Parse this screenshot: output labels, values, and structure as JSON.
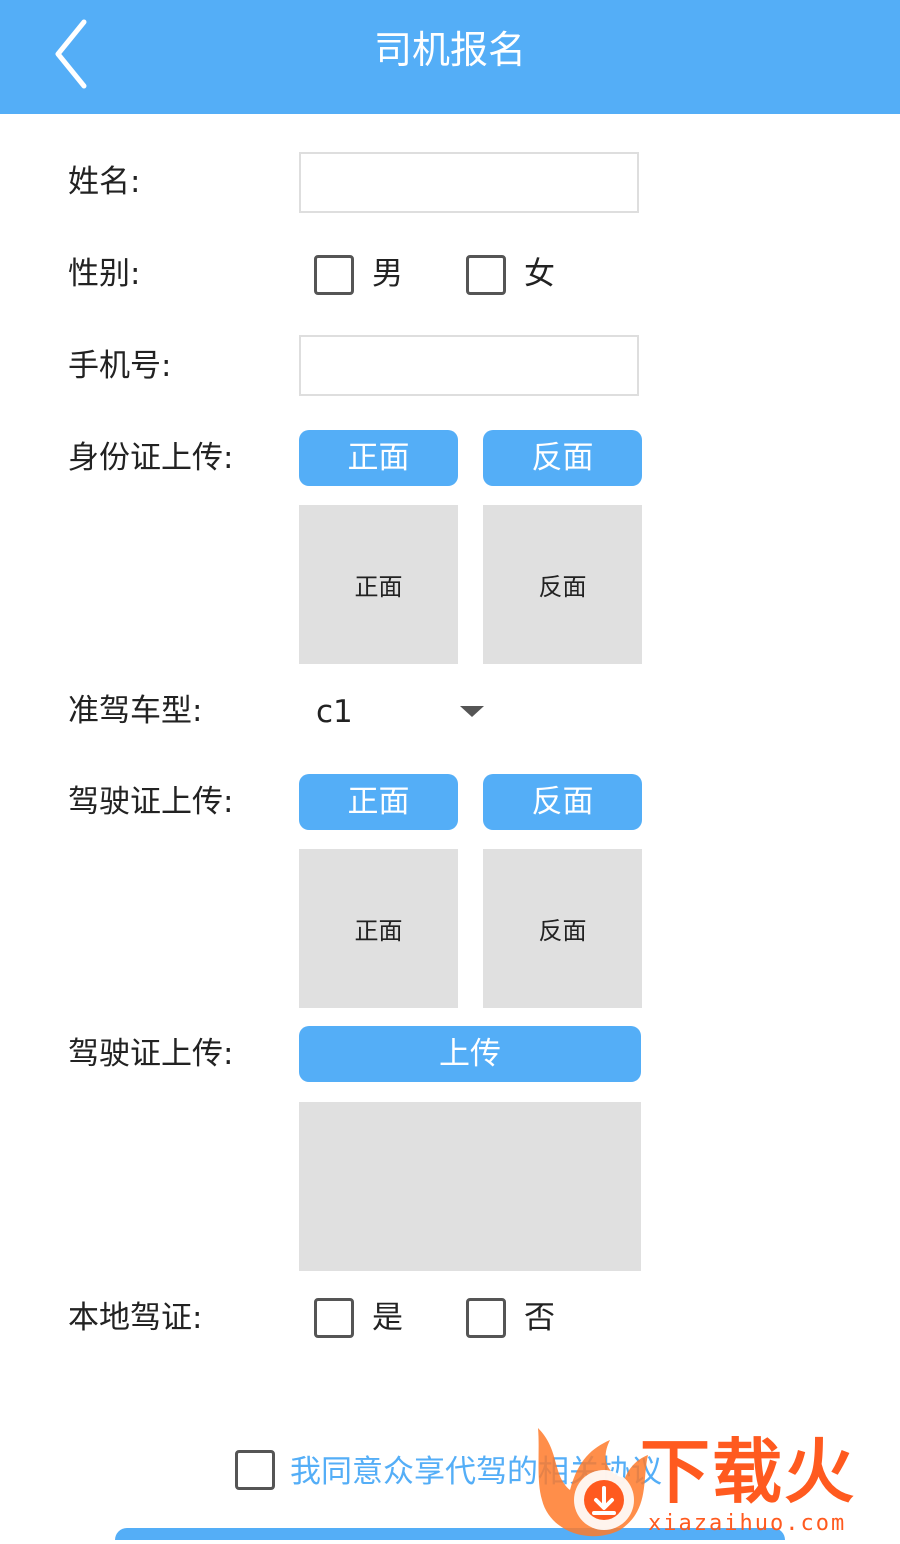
{
  "header": {
    "title": "司机报名"
  },
  "form": {
    "name_label": "姓名:",
    "name_value": "",
    "gender_label": "性别:",
    "gender_options": [
      "男",
      "女"
    ],
    "phone_label": "手机号:",
    "phone_value": "",
    "id_upload_label": "身份证上传:",
    "id_buttons": [
      "正面",
      "反面"
    ],
    "id_previews": [
      "正面",
      "反面"
    ],
    "vehicle_type_label": "准驾车型:",
    "vehicle_type_value": "c1",
    "license_upload_label": "驾驶证上传:",
    "license_buttons": [
      "正面",
      "反面"
    ],
    "license_previews": [
      "正面",
      "反面"
    ],
    "license_upload2_label": "驾驶证上传:",
    "license_upload2_button": "上传",
    "local_license_label": "本地驾证:",
    "local_license_options": [
      "是",
      "否"
    ],
    "agree_text": "我同意众享代驾的相关协议"
  },
  "watermark": {
    "text": "下载火",
    "sub": "xiazaihuo.com"
  },
  "colors": {
    "accent": "#54aef7",
    "preview_bg": "#e0e0e0",
    "watermark": "#ff5a1f"
  }
}
